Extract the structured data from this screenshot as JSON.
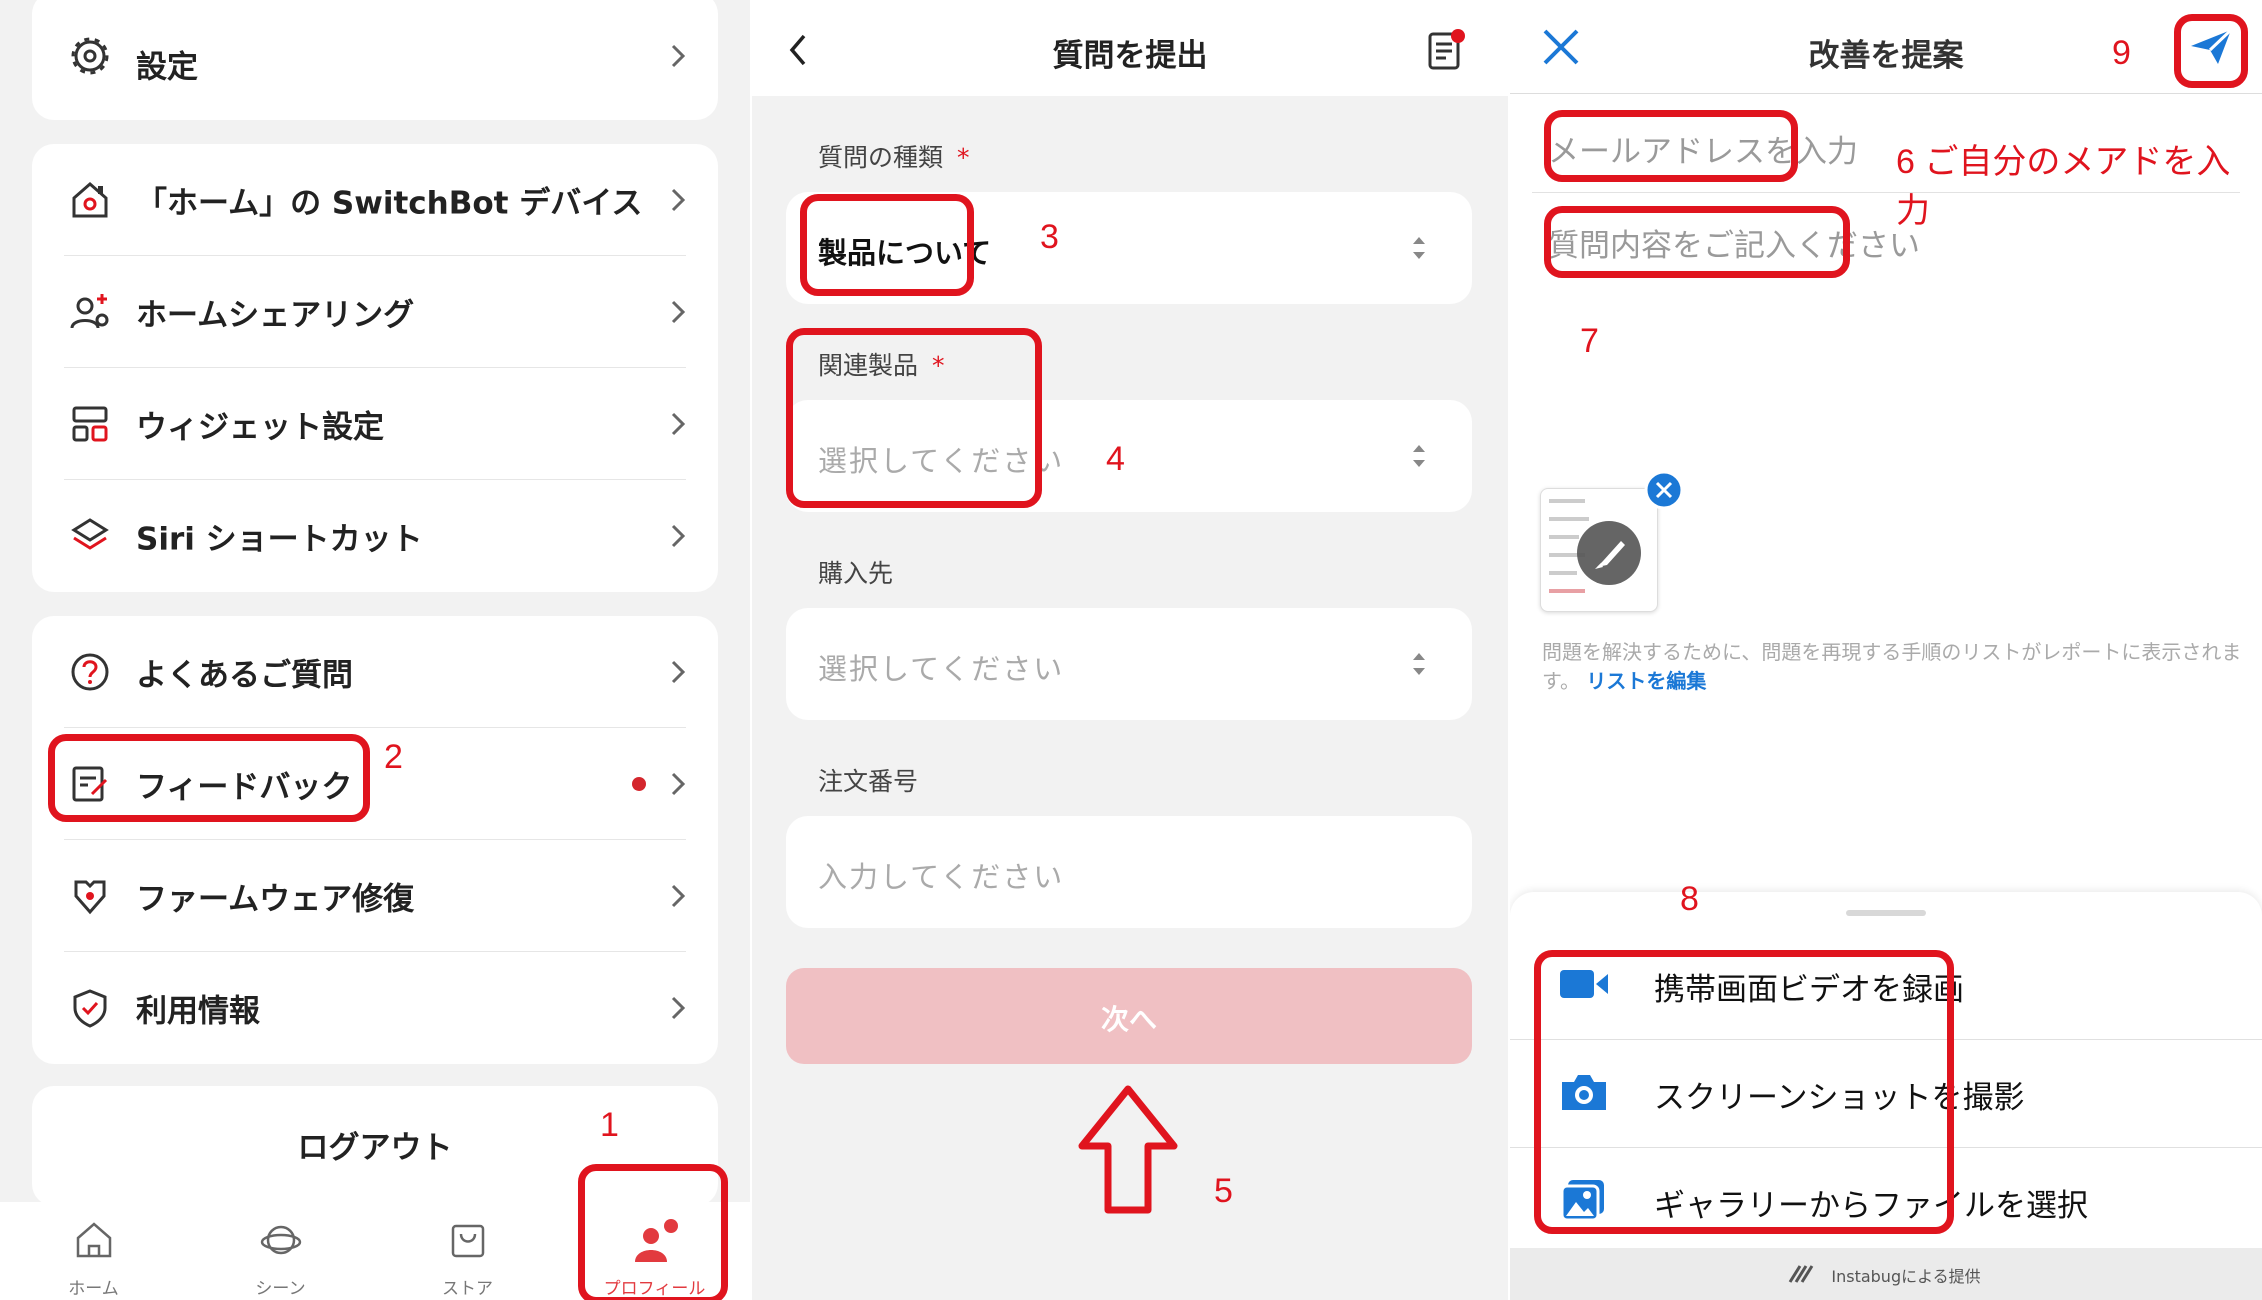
{
  "panel1": {
    "settings": "設定",
    "home_devices": "「ホーム」の SwitchBot デバイス",
    "home_sharing": "ホームシェアリング",
    "widget": "ウィジェット設定",
    "siri": "Siri ショートカット",
    "faq": "よくあるご質問",
    "feedback": "フィードバック",
    "firmware": "ファームウェア修復",
    "terms": "利用情報",
    "logout": "ログアウト",
    "tabs": [
      "ホーム",
      "シーン",
      "ストア",
      "プロフィール"
    ]
  },
  "panel2": {
    "title": "質問を提出",
    "type_label": "質問の種類",
    "type_value": "製品について",
    "product_label": "関連製品",
    "product_placeholder": "選択してください",
    "store_label": "購入先",
    "store_placeholder": "選択してください",
    "order_label": "注文番号",
    "order_placeholder": "入力してください",
    "next": "次へ",
    "required_mark": "*"
  },
  "panel3": {
    "title": "改善を提案",
    "email_placeholder": "メールアドレスを入力",
    "question_placeholder": "質問内容をご記入ください",
    "note": "問題を解決するために、問題を再現する手順のリストがレポートに表示されます。",
    "note_link": "リストを編集",
    "record_video": "携帯画面ビデオを録画",
    "screenshot": "スクリーンショットを撮影",
    "gallery": "ギャラリーからファイルを選択",
    "powered_by": "Instabugによる提供"
  },
  "annotations": {
    "n1": "1",
    "n2": "2",
    "n3": "3",
    "n4": "4",
    "n5": "5",
    "n6": "6 ご自分のメアドを入力",
    "n7": "7",
    "n8": "8",
    "n9": "9"
  },
  "colors": {
    "brand_red": "#e23a3f",
    "annotation_red": "#e0141e",
    "link_blue": "#1b78d6"
  }
}
